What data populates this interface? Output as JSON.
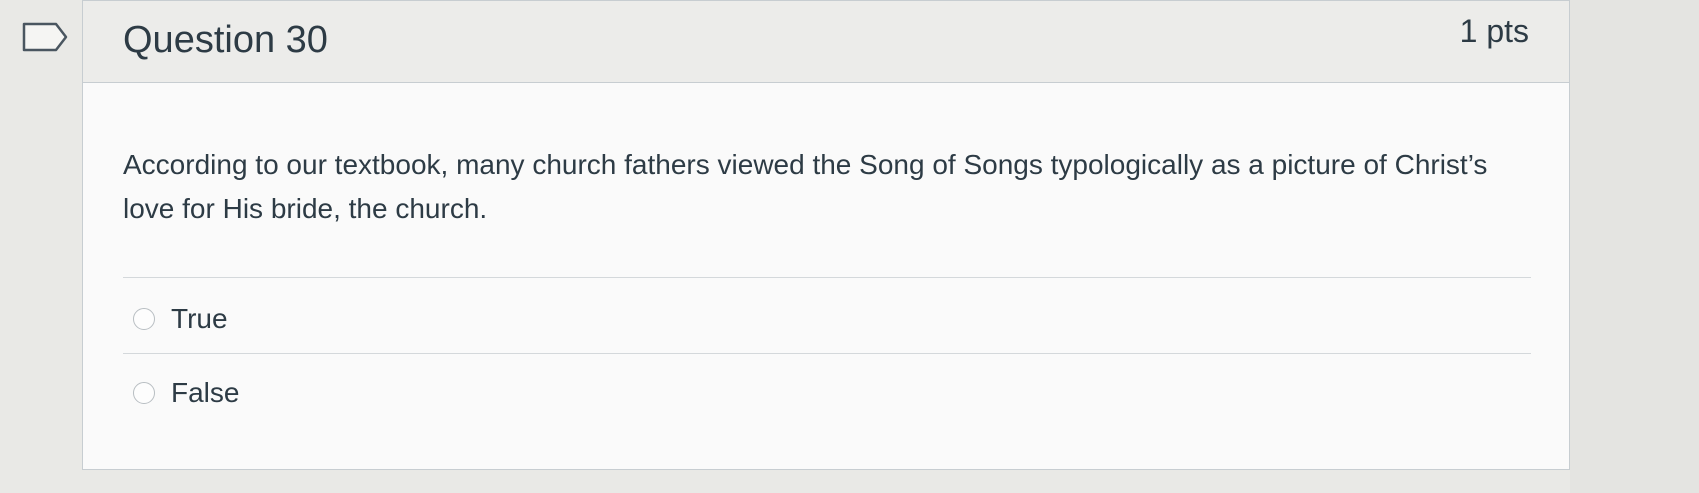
{
  "question": {
    "title": "Question 30",
    "points": "1 pts",
    "text": "According to our textbook, many church fathers viewed the Song of Songs typologically as a picture of Christ’s love for His bride, the church.",
    "answers": [
      {
        "label": "True",
        "selected": false
      },
      {
        "label": "False",
        "selected": false
      }
    ]
  },
  "colors": {
    "text": "#2d3b45",
    "header_bg": "#ececea",
    "border": "#c7cdd1"
  },
  "icons": {
    "flag": "flag-question-icon"
  }
}
